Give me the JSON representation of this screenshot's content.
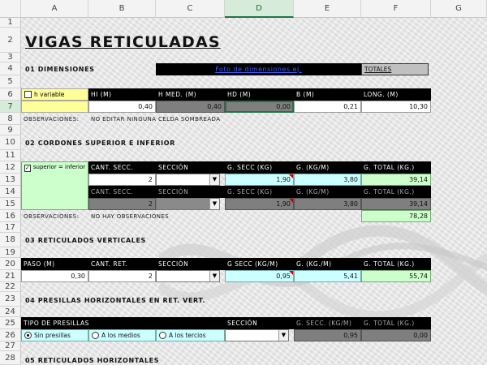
{
  "columns": [
    "A",
    "B",
    "C",
    "D",
    "E",
    "F",
    "G"
  ],
  "rows": [
    "1",
    "2",
    "3",
    "4",
    "5",
    "6",
    "7",
    "8",
    "9",
    "10",
    "11",
    "12",
    "13",
    "14",
    "15",
    "16",
    "17",
    "18",
    "19",
    "20",
    "21",
    "22",
    "23",
    "24",
    "25",
    "26",
    "27",
    "28"
  ],
  "title": "VIGAS RETICULADAS",
  "sections": {
    "dimensiones": "01 DIMENSIONES",
    "cordones": "02 CORDONES SUPERIOR E INFERIOR",
    "reticulados_verticales": "03 RETICULADOS VERTICALES",
    "presillas": "04 PRESILLAS HORIZONTALES EN RET. VERT.",
    "reticulados_horizontales": "05 RETICULADOS HORIZONTALES"
  },
  "dimensiones": {
    "link_text": "Foto de dimensiones ej.",
    "totales_label": "TOTALES",
    "h_variable_label": "h variable",
    "headers": [
      "HI (M)",
      "H MED. (M)",
      "HD (M)",
      "B (M)",
      "LONG. (M)"
    ],
    "values": [
      "0,40",
      "0,40",
      "0,00",
      "0,21",
      "10,30"
    ],
    "obs_label": "OBSERVACIONES:",
    "obs_text": "NO EDITAR NINGUNA CELDA SOMBREADA"
  },
  "cordones": {
    "checkbox_label": "superior = inferior",
    "checkbox_mark": "✓",
    "headers": [
      "CANT. SECC.",
      "SECCIÓN",
      "G. SECC (KG)",
      "G. (KG/M)",
      "G. TOTAL (KG.)"
    ],
    "superior": {
      "cant": "2",
      "g_secc": "1,90",
      "g_m": "3,80",
      "g_total": "39,14"
    },
    "inferior": {
      "cant": "2",
      "g_secc": "1,90",
      "g_m": "3,80",
      "g_total": "39,14"
    },
    "obs_label": "OBSERVACIONES:",
    "obs_text": "NO HAY OBSERVACIONES",
    "total": "78,28"
  },
  "verticales": {
    "headers": [
      "PASO (M)",
      "CANT. RET.",
      "SECCIÓN",
      "G SECC (KG/M)",
      "G. (KG./M)",
      "G. TOTAL (KG.)"
    ],
    "values": {
      "paso": "0,30",
      "cant": "2",
      "g_secc": "0,95",
      "g_m": "5,41",
      "g_total": "55,74"
    }
  },
  "presillas": {
    "tipo_label": "TIPO DE PRESILLAS",
    "headers": [
      "SECCIÓN",
      "G. SECC. (KG/M)",
      "G. TOTAL (KG.)"
    ],
    "options": [
      "Sin presillas",
      "A los medios",
      "A los tercios"
    ],
    "selected": 0,
    "g_secc": "0,95",
    "g_total": "0,00"
  },
  "icons": {
    "dropdown": "▼"
  },
  "colors": {
    "excel_green": "#217346",
    "cyan_cell": "#ccffff",
    "green_cell": "#ccffcc",
    "yellow_cell": "#ffff99",
    "dark_cell": "#7f7f7f"
  }
}
